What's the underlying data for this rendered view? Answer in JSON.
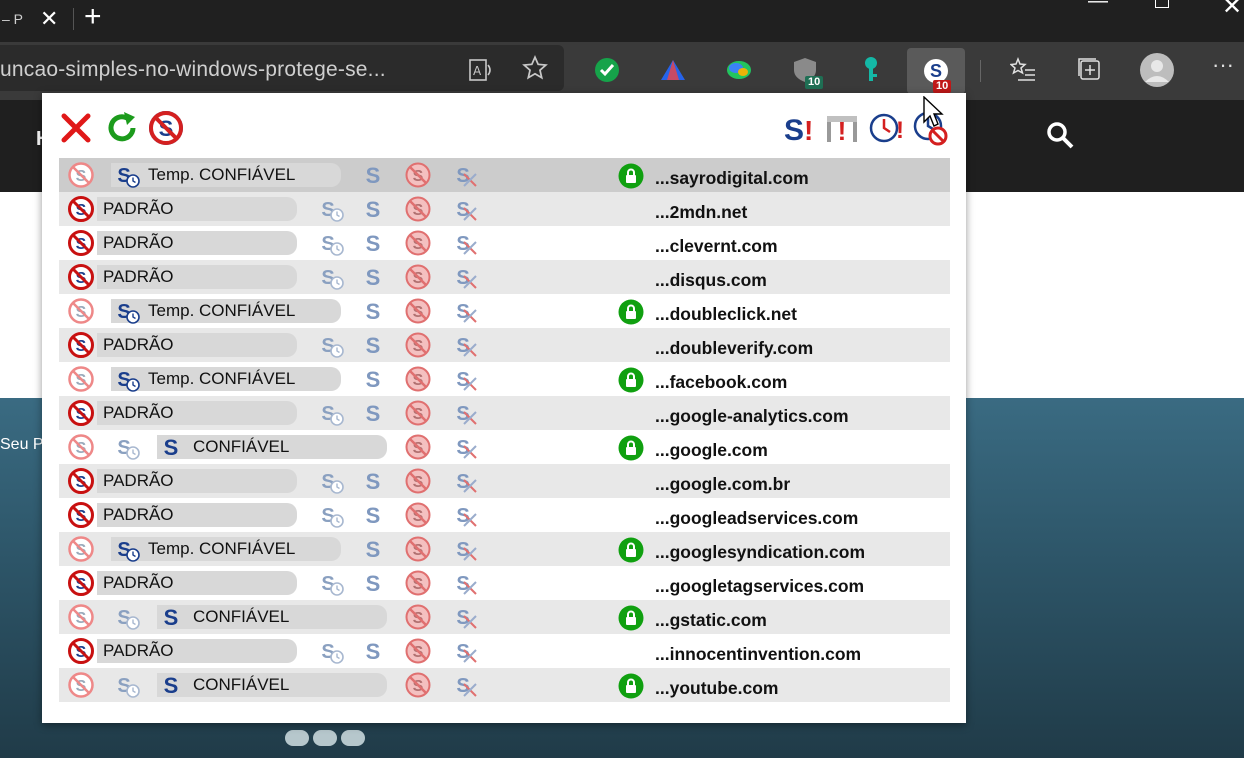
{
  "browser": {
    "tab_title": "– P",
    "close_tab_glyph": "✕",
    "new_tab_glyph": "+",
    "address_text": "uncao-simples-no-windows-protege-se...",
    "extensions": [
      {
        "name": "check-extension",
        "color": "#16a34a"
      },
      {
        "name": "triangle-extension",
        "color": "#3b82f6"
      },
      {
        "name": "globe-extension",
        "color": "#22c55e"
      },
      {
        "name": "shield-extension",
        "badge": "10",
        "badge_color": "#1f6f54"
      },
      {
        "name": "key-extension",
        "color": "#14b8a6"
      },
      {
        "name": "scriptsafe-extension",
        "badge": "10",
        "badge_color": "#c01818"
      }
    ]
  },
  "page": {
    "nav_letter": "H",
    "hero_text": "Seu P"
  },
  "popup": {
    "colors": {
      "red": "#d42020",
      "blue": "#1a3e8c",
      "green": "#1c9b1c",
      "lock_green": "#10a010",
      "row_alt": "#e8e8e8"
    },
    "rows": [
      {
        "domain": "...sayrodigital.com",
        "status": "Temp. CONFIÁVEL",
        "kind": "temp",
        "lock": true
      },
      {
        "domain": "...2mdn.net",
        "status": "PADRÃO",
        "kind": "default",
        "lock": false
      },
      {
        "domain": "...clevernt.com",
        "status": "PADRÃO",
        "kind": "default",
        "lock": false
      },
      {
        "domain": "...disqus.com",
        "status": "PADRÃO",
        "kind": "default",
        "lock": false
      },
      {
        "domain": "...doubleclick.net",
        "status": "Temp. CONFIÁVEL",
        "kind": "temp",
        "lock": true
      },
      {
        "domain": "...doubleverify.com",
        "status": "PADRÃO",
        "kind": "default",
        "lock": false
      },
      {
        "domain": "...facebook.com",
        "status": "Temp. CONFIÁVEL",
        "kind": "temp",
        "lock": true
      },
      {
        "domain": "...google-analytics.com",
        "status": "PADRÃO",
        "kind": "default",
        "lock": false
      },
      {
        "domain": "...google.com",
        "status": "CONFIÁVEL",
        "kind": "trusted",
        "lock": true
      },
      {
        "domain": "...google.com.br",
        "status": "PADRÃO",
        "kind": "default",
        "lock": false
      },
      {
        "domain": "...googleadservices.com",
        "status": "PADRÃO",
        "kind": "default",
        "lock": false
      },
      {
        "domain": "...googlesyndication.com",
        "status": "Temp. CONFIÁVEL",
        "kind": "temp",
        "lock": true
      },
      {
        "domain": "...googletagservices.com",
        "status": "PADRÃO",
        "kind": "default",
        "lock": false
      },
      {
        "domain": "...gstatic.com",
        "status": "CONFIÁVEL",
        "kind": "trusted",
        "lock": true
      },
      {
        "domain": "...innocentinvention.com",
        "status": "PADRÃO",
        "kind": "default",
        "lock": false
      },
      {
        "domain": "...youtube.com",
        "status": "CONFIÁVEL",
        "kind": "trusted",
        "lock": true
      }
    ]
  }
}
